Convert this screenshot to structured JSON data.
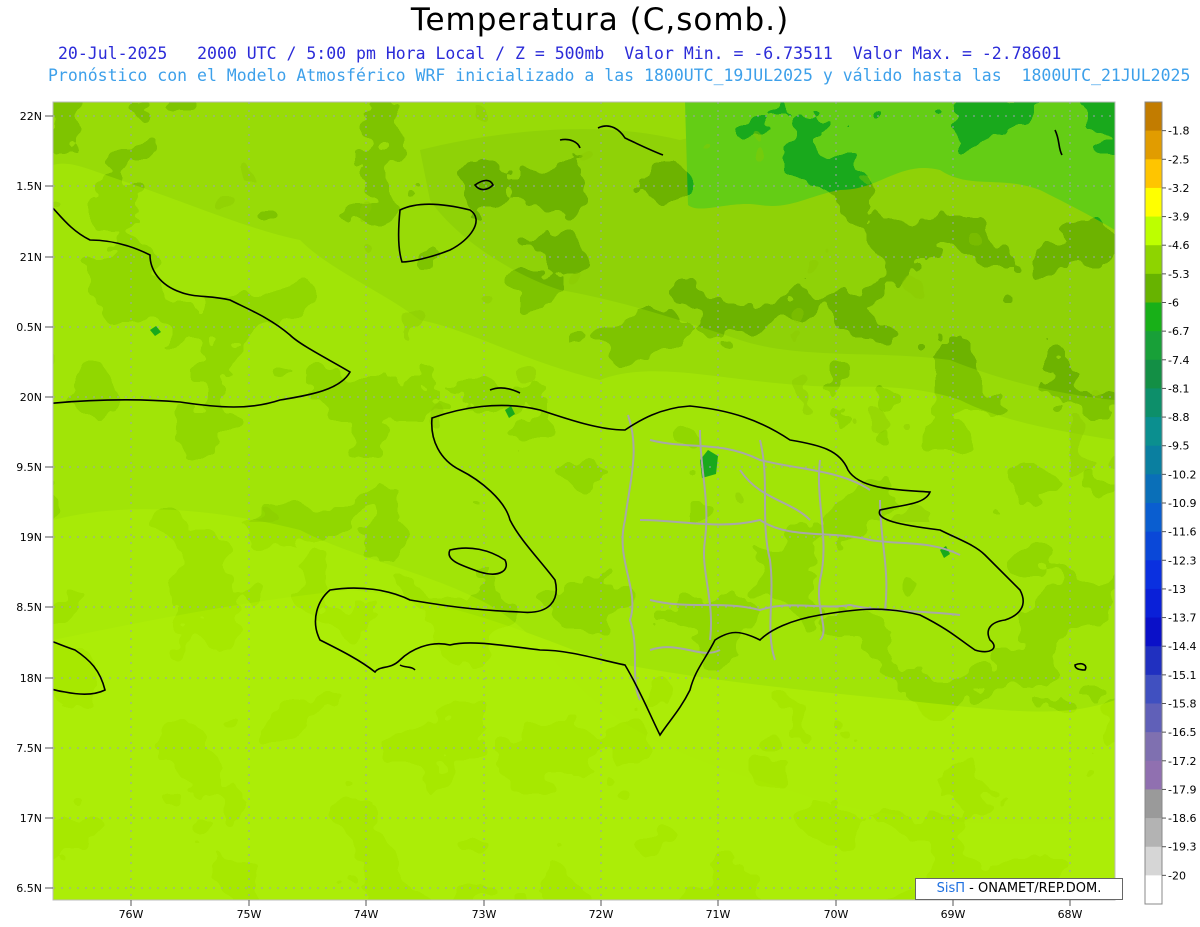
{
  "title": "Temperatura (C,somb.)",
  "subtitle_1": "20-Jul-2025   2000 UTC / 5:00 pm Hora Local / Z = 500mb  Valor Min. = -6.73511  Valor Max. = -2.78601",
  "subtitle_2": "Pronóstico con el Modelo Atmosférico WRF inicializado a las 1800UTC_19JUL2025 y válido hasta las  1800UTC_21JUL2025",
  "lat_labels": [
    "22N",
    "1.5N",
    "21N",
    "0.5N",
    "20N",
    "9.5N",
    "19N",
    "8.5N",
    "18N",
    "7.5N",
    "17N",
    "6.5N"
  ],
  "lon_labels": [
    "76W",
    "75W",
    "74W",
    "73W",
    "72W",
    "71W",
    "70W",
    "69W",
    "68W"
  ],
  "colorbar": {
    "labels": [
      "-1.8",
      "-2.5",
      "-3.2",
      "-3.9",
      "-4.6",
      "-5.3",
      "-6",
      "-6.7",
      "-7.4",
      "-8.1",
      "-8.8",
      "-9.5",
      "-10.2",
      "-10.9",
      "-11.6",
      "-12.3",
      "-13",
      "-13.7",
      "-14.4",
      "-15.1",
      "-15.8",
      "-16.5",
      "-17.2",
      "-17.9",
      "-18.6",
      "-19.3",
      "-20"
    ],
    "colors": [
      "#c27c00",
      "#e19c00",
      "#ffc500",
      "#ffff00",
      "#bdff00",
      "#8ed400",
      "#67b300",
      "#18b018",
      "#18a038",
      "#138f45",
      "#0d8f6a",
      "#0b8f8f",
      "#0a7fa0",
      "#0a6fb8",
      "#0a5ed0",
      "#0a48d8",
      "#0a30e0",
      "#0a20d8",
      "#0a10c8",
      "#2030c0",
      "#4050c0",
      "#6060b8",
      "#7f70b0",
      "#9070b0",
      "#9a9a9a",
      "#b3b3b3",
      "#d6d6d6",
      "#ffffff"
    ]
  },
  "credit": {
    "sis": "SisΠ",
    "rest": "- ONAMET/REP.DOM."
  }
}
